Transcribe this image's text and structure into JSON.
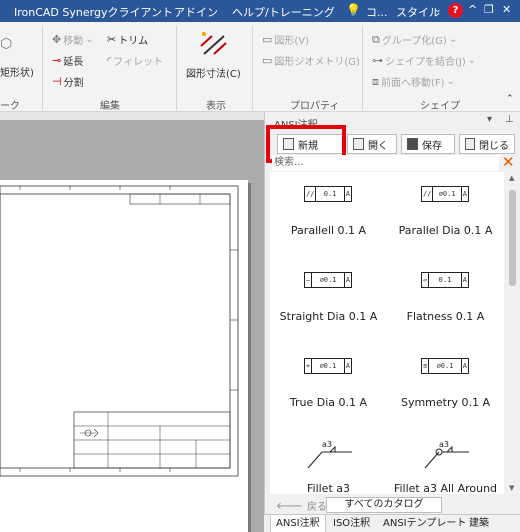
{
  "menubar": {
    "app": "IronCAD Synergyクライアント",
    "addin": "アドイン",
    "help_training": "ヘルプ/トレーニング",
    "user_short": "コ...",
    "style": "スタイル",
    "help_icon": "?"
  },
  "ribbon": {
    "sketch_label": "矩形状)",
    "sketch_group": "ーク",
    "edit": {
      "move": "移動",
      "trim": "トリム",
      "extend": "延長",
      "fillet": "フィレット",
      "split": "分割",
      "group": "編集"
    },
    "display": {
      "dimension": "図形寸法(C)",
      "group": "表示"
    },
    "properties": {
      "shape": "図形(V)",
      "geometry": "図形ジオメトリ(G)",
      "group": "プロパティ"
    },
    "shape": {
      "group_btn": "グループ化(G)",
      "combine": "シェイプを結合(J)",
      "bring_front": "前面へ移動(F)",
      "group": "シェイプ"
    }
  },
  "panel": {
    "title": "ANSI注釈",
    "toolbar": {
      "new": "新規",
      "open": "開く",
      "save": "保存",
      "close": "閉じる"
    },
    "search_placeholder": "検索...",
    "items": [
      {
        "label": "Parallell 0.1 A",
        "sym": "//",
        "val": "0.1",
        "ref": "A"
      },
      {
        "label": "Parallel Dia 0.1 A",
        "sym": "//",
        "val": "⌀0.1",
        "ref": "A"
      },
      {
        "label": "Straight Dia 0.1 A",
        "sym": "—",
        "val": "⌀0.1",
        "ref": "A"
      },
      {
        "label": "Flatness 0.1 A",
        "sym": "▱",
        "val": "0.1",
        "ref": "A"
      },
      {
        "label": "True Dia 0.1 A",
        "sym": "⌖",
        "val": "⌀0.1",
        "ref": "A"
      },
      {
        "label": "Symmetry 0.1 A",
        "sym": "≡",
        "val": "⌀0.1",
        "ref": "A"
      },
      {
        "label": "Fillet a3",
        "sym": "a3",
        "val": "",
        "ref": ""
      },
      {
        "label": "Fillet a3 All Around",
        "sym": "a3",
        "val": "",
        "ref": ""
      }
    ],
    "nav": {
      "back": "戻る",
      "all_catalogs": "すべてのカタログ"
    },
    "tabs": [
      "ANSI注釈",
      "ISO注釈",
      "ANSIテンプレート",
      "建築"
    ]
  },
  "colors": {
    "titlebar": "#2b579a",
    "highlight": "#e8000b",
    "canvas_bg": "#ababab"
  }
}
